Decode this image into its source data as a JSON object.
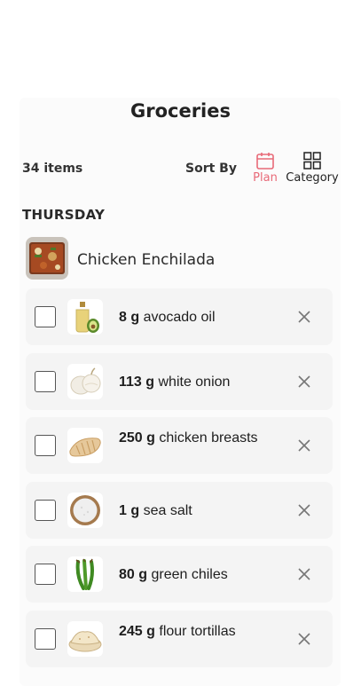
{
  "header": {
    "title": "Groceries"
  },
  "toolbar": {
    "item_count": "34 items",
    "sort_by_label": "Sort By",
    "sort_options": [
      {
        "label": "Plan",
        "icon": "calendar-icon",
        "active": true,
        "color": "#e86a78"
      },
      {
        "label": "Category",
        "icon": "grid-icon",
        "active": false
      }
    ]
  },
  "section": {
    "day": "THURSDAY",
    "recipe": {
      "name": "Chicken Enchilada"
    },
    "items": [
      {
        "qty": "8 g",
        "name": "avocado oil",
        "icon": "avocado-oil-icon"
      },
      {
        "qty": "113 g",
        "name": "white onion",
        "icon": "onion-icon"
      },
      {
        "qty": "250 g",
        "name": "chicken breasts",
        "icon": "chicken-icon"
      },
      {
        "qty": "1 g",
        "name": "sea salt",
        "icon": "salt-icon"
      },
      {
        "qty": "80 g",
        "name": "green chiles",
        "icon": "chiles-icon"
      },
      {
        "qty": "245 g",
        "name": "flour tortillas",
        "icon": "tortillas-icon"
      }
    ]
  }
}
